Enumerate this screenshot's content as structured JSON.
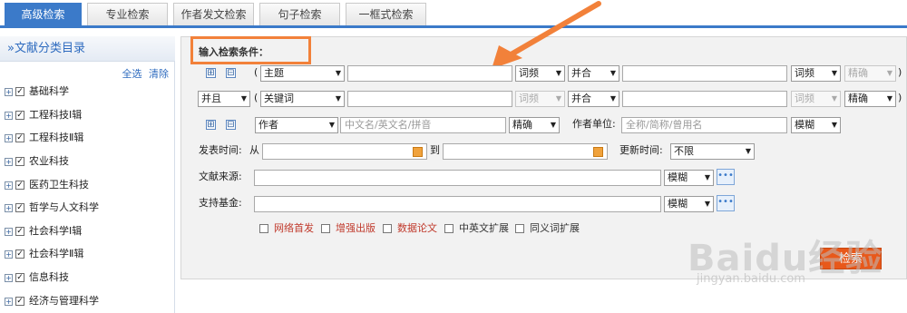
{
  "tabs": [
    "高级检索",
    "专业检索",
    "作者发文检索",
    "句子检索",
    "一框式检索"
  ],
  "sidebar": {
    "title": "»文献分类目录",
    "select_all": "全选",
    "clear": "清除",
    "plus": "+",
    "check": "✓",
    "items": [
      "基础科学",
      "工程科技Ⅰ辑",
      "工程科技Ⅱ辑",
      "农业科技",
      "医药卫生科技",
      "哲学与人文科学",
      "社会科学Ⅰ辑",
      "社会科学Ⅱ辑",
      "信息科技",
      "经济与管理科学"
    ]
  },
  "condition_title": "输入检索条件：",
  "controls": {
    "plus": "⊞",
    "minus": "⊟",
    "paren_open": "(",
    "paren_close": ")",
    "dots": "•••"
  },
  "row1": {
    "field": "主题",
    "freq1": "词频",
    "op": "并合",
    "freq2": "词频",
    "match": "精确"
  },
  "row2": {
    "logic": "并且",
    "field": "关键词",
    "freq1": "词频",
    "op": "并合",
    "freq2": "词频",
    "match": "精确"
  },
  "row3": {
    "field": "作者",
    "name_placeholder": "中文名/英文名/拼音",
    "match": "精确",
    "unit_label": "作者单位:",
    "unit_placeholder": "全称/简称/曾用名",
    "unit_match": "模糊"
  },
  "row4": {
    "pub_label": "发表时间:",
    "from": "从",
    "to": "到",
    "update_label": "更新时间:",
    "update_value": "不限"
  },
  "row5": {
    "label": "文献来源:",
    "match": "模糊"
  },
  "row6": {
    "label": "支持基金:",
    "match": "模糊"
  },
  "options": [
    "网络首发",
    "增强出版",
    "数据论文",
    "中英文扩展",
    "同义词扩展"
  ],
  "search_button": "检索",
  "watermark": "Baidu经验",
  "watermark_url": "jingyan.baidu.com",
  "colors": {
    "accent": "#3b7ac9",
    "highlight": "#f2813a",
    "search": "#e8581a",
    "option_red": "#c0392b"
  }
}
